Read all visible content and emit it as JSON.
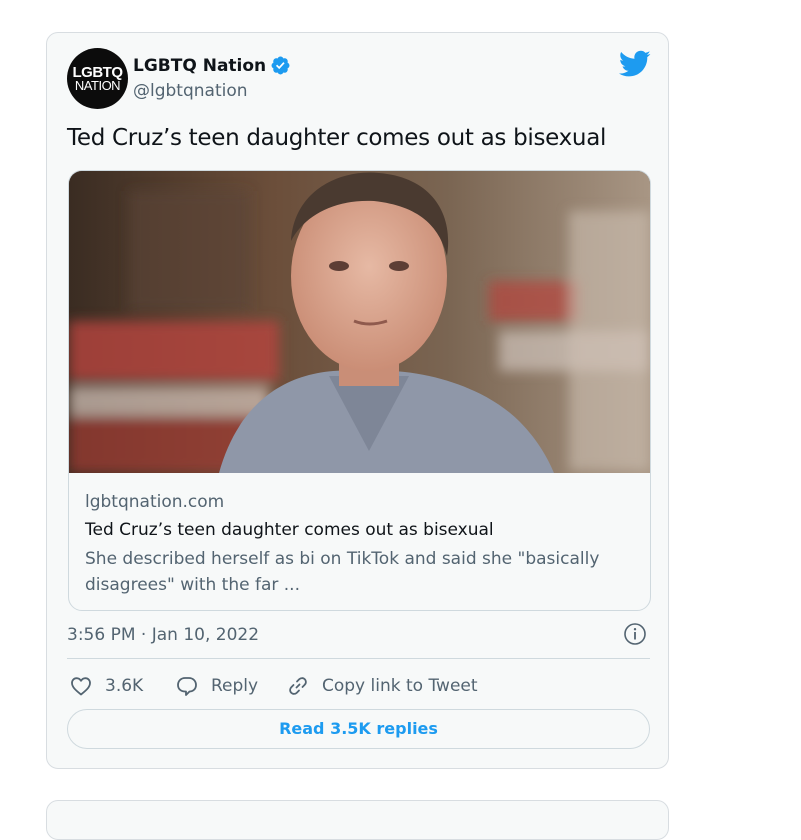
{
  "tweet": {
    "author": {
      "avatar_text_line1": "LGBTQ",
      "avatar_text_line2": "NATION",
      "display_name": "LGBTQ Nation",
      "handle": "@lgbtqnation",
      "verified_icon": "verified-badge-icon"
    },
    "brand_icon": "twitter-bird-icon",
    "text": "Ted Cruz’s teen daughter comes out as bisexual",
    "link_card": {
      "image": "photo of Ted Cruz",
      "domain": "lgbtqnation.com",
      "title": "Ted Cruz’s teen daughter comes out as bisexual",
      "description": "She described herself as bi on TikTok and said she \"basically disagrees\" with the far ..."
    },
    "timestamp": "3:56 PM · Jan 10, 2022",
    "info_icon": "info-icon",
    "actions": {
      "like_count": "3.6K",
      "reply_label": "Reply",
      "copy_label": "Copy link to Tweet"
    },
    "read_replies_label": "Read 3.5K replies"
  },
  "colors": {
    "accent": "#1d9bf0",
    "card_background": "#f7f9f9",
    "secondary_text": "#536471",
    "border": "#cfd9de"
  }
}
